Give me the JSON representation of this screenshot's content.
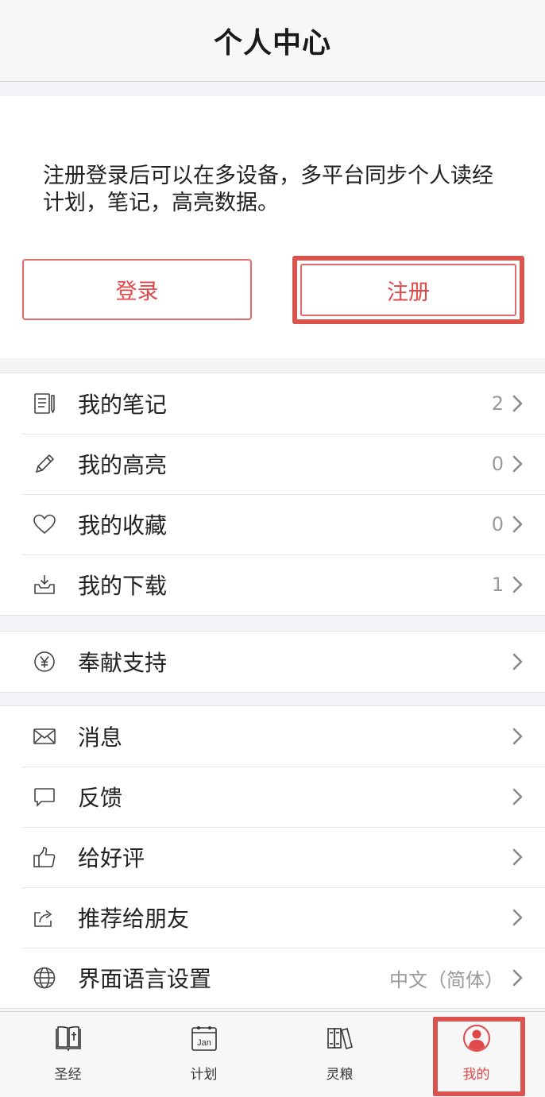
{
  "header": {
    "title": "个人中心"
  },
  "login": {
    "description": "注册登录后可以在多设备，多平台同步个人读经计划，笔记，高亮数据。",
    "login_label": "登录",
    "register_label": "注册"
  },
  "groups": [
    {
      "items": [
        {
          "label": "我的笔记",
          "value": "2",
          "icon": "notes-icon"
        },
        {
          "label": "我的高亮",
          "value": "0",
          "icon": "pencil-icon"
        },
        {
          "label": "我的收藏",
          "value": "0",
          "icon": "heart-icon"
        },
        {
          "label": "我的下载",
          "value": "1",
          "icon": "download-tray-icon"
        }
      ]
    },
    {
      "items": [
        {
          "label": "奉献支持",
          "value": "",
          "icon": "yen-coin-icon"
        }
      ]
    },
    {
      "items": [
        {
          "label": "消息",
          "value": "",
          "icon": "envelope-icon"
        },
        {
          "label": "反馈",
          "value": "",
          "icon": "speech-bubble-icon"
        },
        {
          "label": "给好评",
          "value": "",
          "icon": "thumbs-up-icon"
        },
        {
          "label": "推荐给朋友",
          "value": "",
          "icon": "share-icon"
        },
        {
          "label": "界面语言设置",
          "value": "中文（简体）",
          "icon": "globe-icon"
        }
      ]
    }
  ],
  "tabbar": {
    "tabs": [
      {
        "label": "圣经",
        "icon": "bible-icon"
      },
      {
        "label": "计划",
        "icon": "calendar-icon"
      },
      {
        "label": "灵粮",
        "icon": "books-icon"
      },
      {
        "label": "我的",
        "icon": "profile-icon"
      }
    ],
    "calendar_text": "Jan",
    "active_index": 3
  },
  "colors": {
    "accent": "#e0484a",
    "highlight": "#d9534f"
  }
}
